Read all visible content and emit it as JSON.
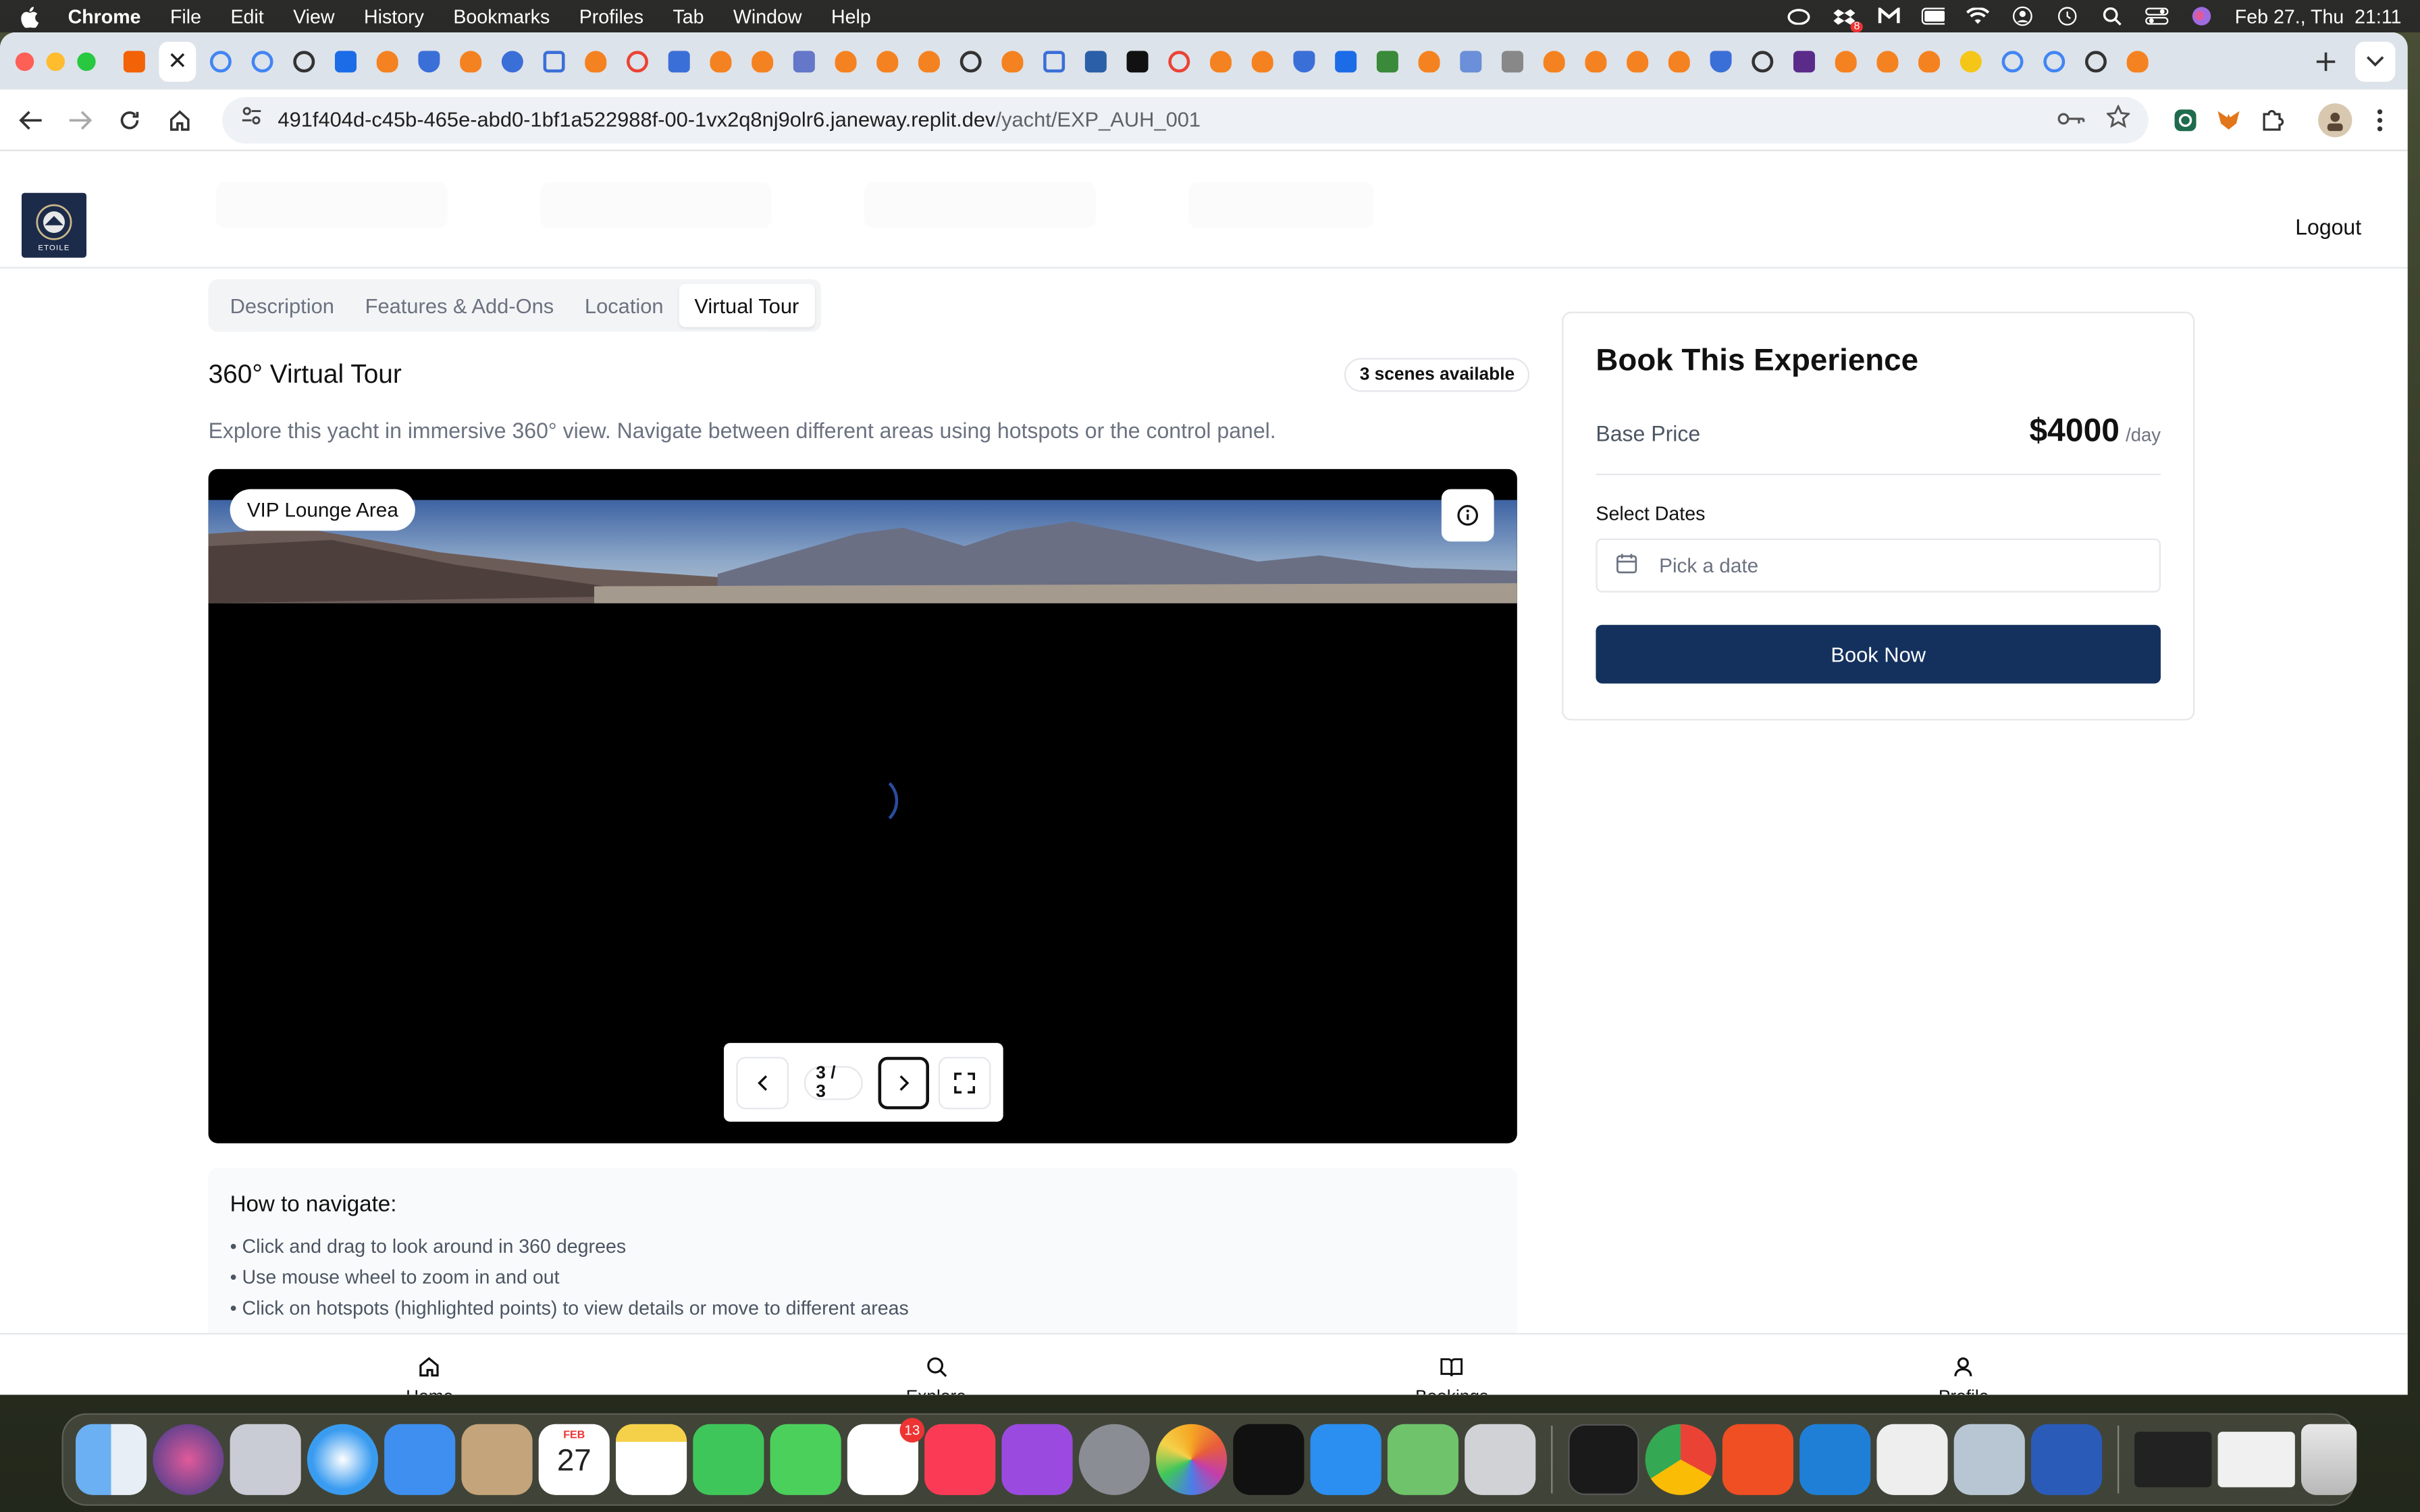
{
  "menubar": {
    "app": "Chrome",
    "items": [
      "File",
      "Edit",
      "View",
      "History",
      "Bookmarks",
      "Profiles",
      "Tab",
      "Window",
      "Help"
    ],
    "clock": "Feb 27., Thu  21:11",
    "notification_count": "8"
  },
  "browser": {
    "url_host": "491f404d-c45b-465e-abd0-1bf1a522988f-00-1vx2q8nj9olr6.janeway.replit.dev",
    "url_path": "/yacht/EXP_AUH_001"
  },
  "site": {
    "logout_label": "Logout",
    "logo_text": "ETOILE"
  },
  "tabs": {
    "items": [
      "Description",
      "Features & Add-Ons",
      "Location",
      "Virtual Tour"
    ],
    "active": "Virtual Tour"
  },
  "tour": {
    "title": "360° Virtual Tour",
    "scenes_badge": "3 scenes available",
    "description": "Explore this yacht in immersive 360° view. Navigate between different areas using hotspots or the control panel.",
    "scene_label": "VIP Lounge Area",
    "counter": "3 / 3"
  },
  "howto": {
    "title": "How to navigate:",
    "items": [
      "• Click and drag to look around in 360 degrees",
      "• Use mouse wheel to zoom in and out",
      "• Click on hotspots (highlighted points) to view details or move to different areas"
    ]
  },
  "booking": {
    "title": "Book This Experience",
    "base_price_label": "Base Price",
    "price": "$4000",
    "per": "/day",
    "dates_label": "Select Dates",
    "date_placeholder": "Pick a date",
    "book_label": "Book Now",
    "accent": "#14315e"
  },
  "bottomnav": {
    "items": [
      {
        "label": "Home",
        "icon": "home-icon"
      },
      {
        "label": "Explore",
        "icon": "search-icon"
      },
      {
        "label": "Bookings",
        "icon": "book-open-icon"
      },
      {
        "label": "Profile",
        "icon": "user-icon"
      }
    ]
  },
  "dock": {
    "reminders_badge": "13",
    "calendar_month": "FEB",
    "calendar_day": "27"
  }
}
